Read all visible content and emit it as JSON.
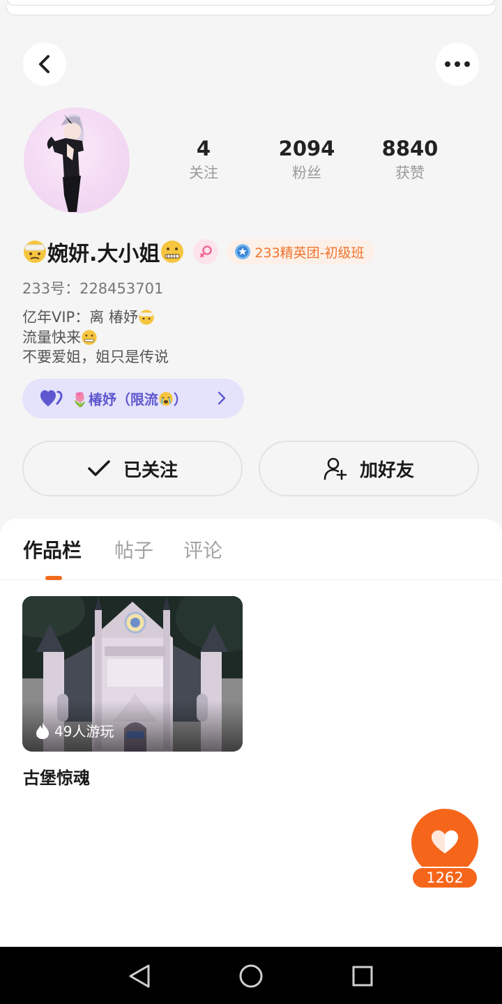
{
  "profile": {
    "name": "婉妍.大小姐",
    "uid": "233号：228453701",
    "badge": "233精英团-初级班",
    "bio": [
      "亿年VIP：离 椿妤",
      "流量快来",
      "不要爱姐，姐只是传说"
    ]
  },
  "stats": [
    {
      "value": "4",
      "label": "关注"
    },
    {
      "value": "2094",
      "label": "粉丝"
    },
    {
      "value": "8840",
      "label": "获赞"
    }
  ],
  "group": {
    "label": "🌷椿妤（限流",
    "suffix": "）"
  },
  "actions": {
    "follow_label": "已关注",
    "add_friend_label": "加好友"
  },
  "tabs": [
    "作品栏",
    "帖子",
    "评论"
  ],
  "works": [
    {
      "title": "古堡惊魂",
      "plays": "49人游玩"
    }
  ],
  "likes": "1262",
  "colors": {
    "accent": "#f5661b",
    "badge_text": "#f0742c",
    "group_bg": "#e4e3fb",
    "group_text": "#5e57cf"
  },
  "icons": [
    "back-icon",
    "more-icon",
    "female-icon",
    "medal-icon",
    "hearts-icon",
    "chevron-right-icon",
    "check-icon",
    "add-user-icon",
    "flame-icon",
    "heart-icon"
  ]
}
